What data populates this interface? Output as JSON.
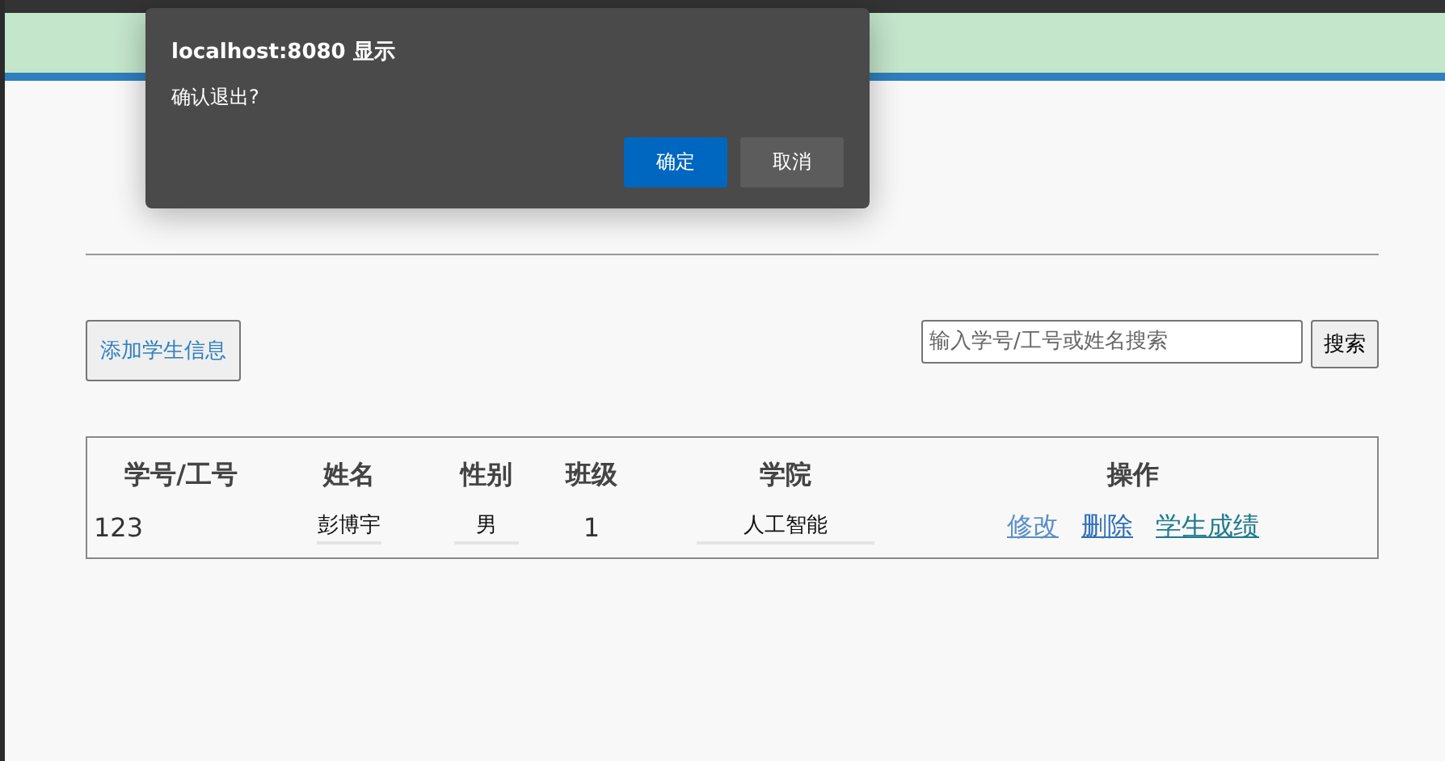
{
  "dialog": {
    "title": "localhost:8080 显示",
    "message": "确认退出?",
    "buttons": [
      {
        "label": "确定",
        "kind": "primary"
      },
      {
        "label": "取消",
        "kind": "secondary"
      }
    ]
  },
  "toolbar": {
    "add_button": "添加学生信息",
    "search": {
      "placeholder": "输入学号/工号或姓名搜索"
    },
    "search_button": "搜索"
  },
  "table": {
    "columns": [
      "学号/工号",
      "姓名",
      "性别",
      "班级",
      "学院",
      "操作"
    ],
    "rows": [
      {
        "id": "123",
        "name": "彭博宇",
        "gender": "男",
        "class": "1",
        "college": "人工智能",
        "actions": [
          {
            "label": "修改",
            "color": "#5b8fc9"
          },
          {
            "label": "删除",
            "color": "#2f6fb7"
          },
          {
            "label": "学生成绩",
            "color": "#1f7a8c"
          }
        ]
      }
    ]
  }
}
